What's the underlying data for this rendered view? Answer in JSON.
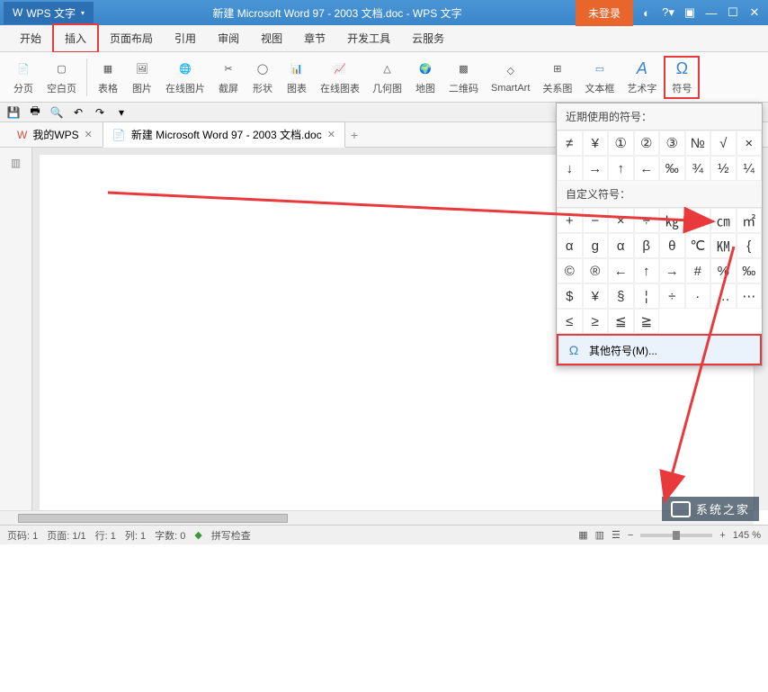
{
  "titlebar": {
    "app_name": "WPS 文字",
    "doc_title": "新建 Microsoft Word 97 - 2003 文档.doc - WPS 文字",
    "login": "未登录"
  },
  "menus": {
    "items": [
      "开始",
      "插入",
      "页面布局",
      "引用",
      "审阅",
      "视图",
      "章节",
      "开发工具",
      "云服务"
    ]
  },
  "ribbon": {
    "items": [
      {
        "label": "分页",
        "icon": "page-break"
      },
      {
        "label": "空白页",
        "icon": "blank-page"
      },
      {
        "label": "表格",
        "icon": "table"
      },
      {
        "label": "图片",
        "icon": "picture"
      },
      {
        "label": "在线图片",
        "icon": "online-pic"
      },
      {
        "label": "截屏",
        "icon": "screenshot"
      },
      {
        "label": "形状",
        "icon": "shapes"
      },
      {
        "label": "图表",
        "icon": "chart"
      },
      {
        "label": "在线图表",
        "icon": "online-chart"
      },
      {
        "label": "几何图",
        "icon": "geometry"
      },
      {
        "label": "地图",
        "icon": "map"
      },
      {
        "label": "二维码",
        "icon": "qrcode"
      },
      {
        "label": "SmartArt",
        "icon": "smartart"
      },
      {
        "label": "关系图",
        "icon": "relation"
      },
      {
        "label": "文本框",
        "icon": "textbox"
      },
      {
        "label": "艺术字",
        "icon": "wordart"
      },
      {
        "label": "符号",
        "icon": "symbol"
      }
    ]
  },
  "tabs": {
    "wps_tab": "我的WPS",
    "doc_tab": "新建 Microsoft Word 97 - 2003 文档.doc"
  },
  "symbol_panel": {
    "recent_header": "近期使用的符号：",
    "custom_header": "自定义符号：",
    "recent": [
      "≠",
      "¥",
      "①",
      "②",
      "③",
      "№",
      "√",
      "×",
      "↓",
      "→",
      "↑",
      "←",
      "‰",
      "¾",
      "½",
      "¼"
    ],
    "custom": [
      "+",
      "−",
      "×",
      "÷",
      "㎏",
      "㎜",
      "㎝",
      "㎡",
      "α",
      "g",
      "α",
      "β",
      "θ",
      "℃",
      "㏎",
      "{",
      "©",
      "®",
      "←",
      "↑",
      "→",
      "#",
      "%",
      "‰",
      "$",
      "¥",
      "§",
      "¦",
      "÷",
      "·",
      "…",
      "⋯",
      "≤",
      "≥",
      "≦",
      "≧"
    ],
    "more": "其他符号(M)..."
  },
  "status": {
    "page": "页码: 1",
    "pages": "页面: 1/1",
    "line": "行: 1",
    "col": "列: 1",
    "words": "字数: 0",
    "spell": "拼写检查",
    "zoom": "145 %"
  },
  "watermark": "系统之家"
}
